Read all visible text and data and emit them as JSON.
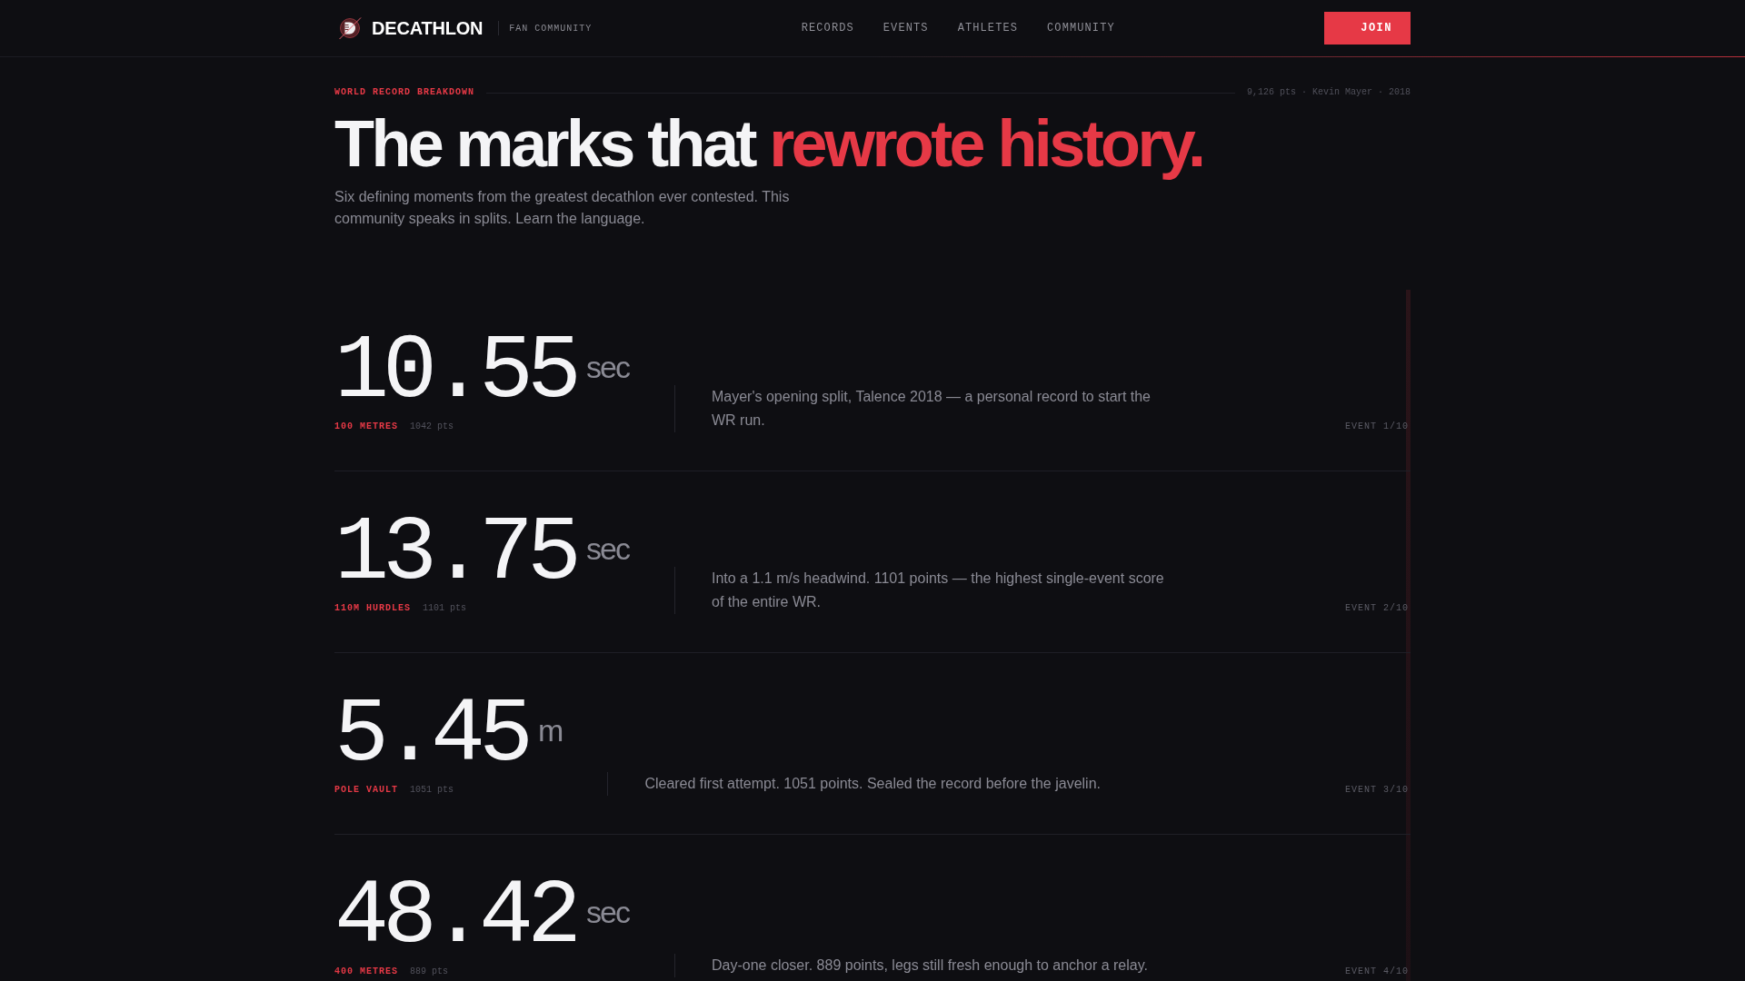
{
  "header": {
    "brand": "DECATHLON",
    "tagline": "FAN COMMUNITY",
    "nav": [
      {
        "label": "RECORDS"
      },
      {
        "label": "EVENTS"
      },
      {
        "label": "ATHLETES"
      },
      {
        "label": "COMMUNITY"
      }
    ],
    "join_button": "JOIN"
  },
  "intro": {
    "eyebrow": "WORLD RECORD BREAKDOWN",
    "meta": "9,126 pts · Kevin Mayer · 2018",
    "title": "The marks that",
    "title_accent": "rewrote history.",
    "lede": "Six defining moments from the greatest decathlon ever contested. This community speaks in splits. Learn the language."
  },
  "records": [
    {
      "value": "10.55",
      "unit": "sec",
      "event": "100 METRES",
      "points": "1042 pts",
      "note": "Mayer's opening split, Talence 2018 — a personal record to start the WR run.",
      "counter": "EVENT 1/10"
    },
    {
      "value": "13.75",
      "unit": "sec",
      "event": "110M HURDLES",
      "points": "1101 pts",
      "note": "Into a 1.1 m/s headwind. 1101 points — the highest single-event score of the entire WR.",
      "counter": "EVENT 2/10"
    },
    {
      "value": "5.45",
      "unit": "m",
      "event": "POLE VAULT",
      "points": "1051 pts",
      "note": "Cleared first attempt. 1051 points. Sealed the record before the javelin.",
      "counter": "EVENT 3/10"
    },
    {
      "value": "48.42",
      "unit": "sec",
      "event": "400 METRES",
      "points": "889 pts",
      "note": "Day-one closer. 889 points, legs still fresh enough to anchor a relay.",
      "counter": "EVENT 4/10"
    }
  ]
}
